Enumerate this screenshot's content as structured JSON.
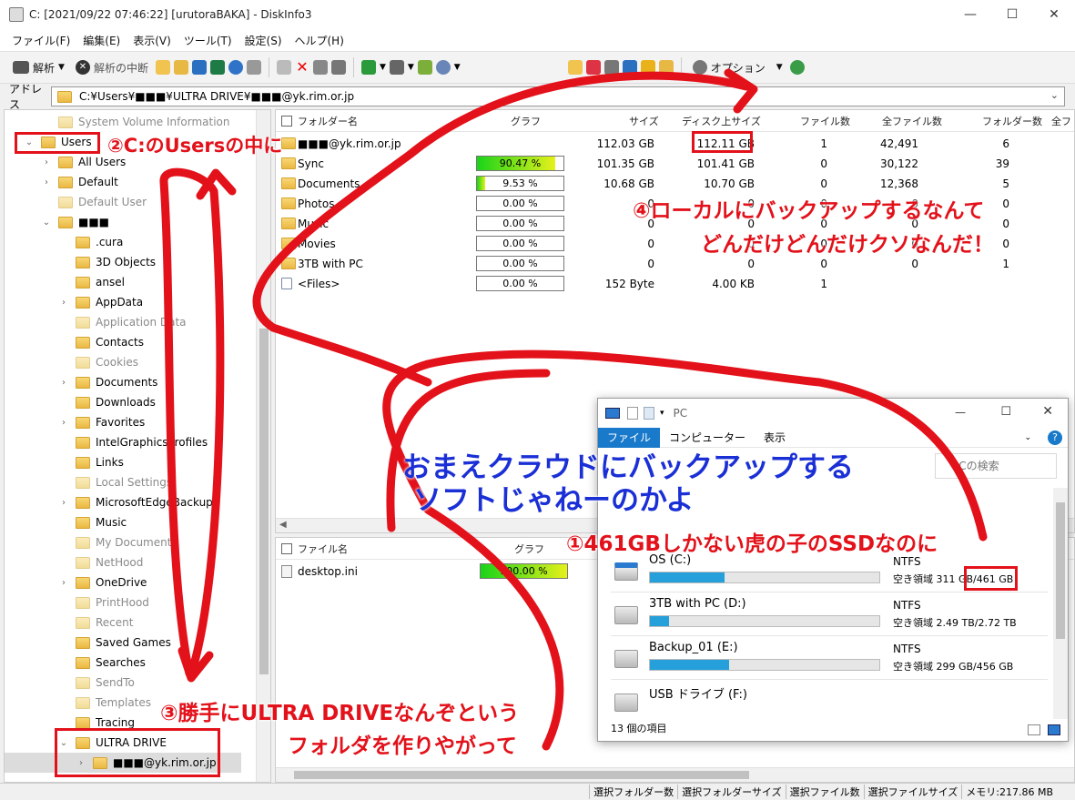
{
  "window": {
    "title": "C: [2021/09/22 07:46:22] [urutoraBAKA] - DiskInfo3",
    "minimize": "—",
    "maximize": "☐",
    "close": "✕"
  },
  "menu": [
    "ファイル(F)",
    "編集(E)",
    "表示(V)",
    "ツール(T)",
    "設定(S)",
    "ヘルプ(H)"
  ],
  "toolbar": {
    "analyze_label": "解析",
    "stop_label": "解析の中断",
    "options_label": "オプション"
  },
  "address": {
    "label": "アドレス",
    "path": "C:¥Users¥■■■¥ULTRA DRIVE¥■■■@yk.rim.or.jp"
  },
  "tree": [
    {
      "label": "System Volume Information",
      "indent": 1,
      "expander": "",
      "dim": true
    },
    {
      "label": "Users",
      "indent": 0,
      "expander": "⌄",
      "dim": false
    },
    {
      "label": "All Users",
      "indent": 1,
      "expander": "›",
      "dim": false
    },
    {
      "label": "Default",
      "indent": 1,
      "expander": "›",
      "dim": false
    },
    {
      "label": "Default User",
      "indent": 1,
      "expander": "",
      "dim": true
    },
    {
      "label": "■■■",
      "indent": 1,
      "expander": "⌄",
      "dim": false
    },
    {
      "label": ".cura",
      "indent": 2,
      "expander": "",
      "dim": false
    },
    {
      "label": "3D Objects",
      "indent": 2,
      "expander": "",
      "dim": false
    },
    {
      "label": "ansel",
      "indent": 2,
      "expander": "",
      "dim": false
    },
    {
      "label": "AppData",
      "indent": 2,
      "expander": "›",
      "dim": false
    },
    {
      "label": "Application Data",
      "indent": 2,
      "expander": "",
      "dim": true
    },
    {
      "label": "Contacts",
      "indent": 2,
      "expander": "",
      "dim": false
    },
    {
      "label": "Cookies",
      "indent": 2,
      "expander": "",
      "dim": true
    },
    {
      "label": "Documents",
      "indent": 2,
      "expander": "›",
      "dim": false
    },
    {
      "label": "Downloads",
      "indent": 2,
      "expander": "",
      "dim": false
    },
    {
      "label": "Favorites",
      "indent": 2,
      "expander": "›",
      "dim": false
    },
    {
      "label": "IntelGraphicsProfiles",
      "indent": 2,
      "expander": "",
      "dim": false
    },
    {
      "label": "Links",
      "indent": 2,
      "expander": "",
      "dim": false
    },
    {
      "label": "Local Settings",
      "indent": 2,
      "expander": "",
      "dim": true
    },
    {
      "label": "MicrosoftEdgeBackups",
      "indent": 2,
      "expander": "›",
      "dim": false
    },
    {
      "label": "Music",
      "indent": 2,
      "expander": "",
      "dim": false
    },
    {
      "label": "My Documents",
      "indent": 2,
      "expander": "",
      "dim": true
    },
    {
      "label": "NetHood",
      "indent": 2,
      "expander": "",
      "dim": true
    },
    {
      "label": "OneDrive",
      "indent": 2,
      "expander": "›",
      "dim": false
    },
    {
      "label": "PrintHood",
      "indent": 2,
      "expander": "",
      "dim": true
    },
    {
      "label": "Recent",
      "indent": 2,
      "expander": "",
      "dim": true
    },
    {
      "label": "Saved Games",
      "indent": 2,
      "expander": "",
      "dim": false
    },
    {
      "label": "Searches",
      "indent": 2,
      "expander": "",
      "dim": false
    },
    {
      "label": "SendTo",
      "indent": 2,
      "expander": "",
      "dim": true
    },
    {
      "label": "Templates",
      "indent": 2,
      "expander": "",
      "dim": true
    },
    {
      "label": "Tracing",
      "indent": 2,
      "expander": "",
      "dim": false
    },
    {
      "label": "ULTRA DRIVE",
      "indent": 2,
      "expander": "⌄",
      "dim": false
    },
    {
      "label": "■■■@yk.rim.or.jp",
      "indent": 3,
      "expander": "›",
      "dim": false
    }
  ],
  "folder_table": {
    "columns": [
      "フォルダー名",
      "グラフ",
      "サイズ",
      "ディスク上サイズ",
      "ファイル数",
      "全ファイル数",
      "フォルダー数",
      "全フ"
    ],
    "rows": [
      {
        "name": "■■■@yk.rim.or.jp",
        "bar": null,
        "bar_label": "",
        "size": "112.03 GB",
        "disk": "112.11 GB",
        "files": "1",
        "allfiles": "42,491",
        "folders": "6"
      },
      {
        "name": "Sync",
        "bar": 90.47,
        "bar_label": "90.47 %",
        "size": "101.35 GB",
        "disk": "101.41 GB",
        "files": "0",
        "allfiles": "30,122",
        "folders": "39"
      },
      {
        "name": "Documents",
        "bar": 9.53,
        "bar_label": "9.53 %",
        "size": "10.68 GB",
        "disk": "10.70 GB",
        "files": "0",
        "allfiles": "12,368",
        "folders": "5"
      },
      {
        "name": "Photos",
        "bar": 0,
        "bar_label": "0.00 %",
        "size": "0",
        "disk": "0",
        "files": "0",
        "allfiles": "0",
        "folders": "0"
      },
      {
        "name": "Music",
        "bar": 0,
        "bar_label": "0.00 %",
        "size": "0",
        "disk": "0",
        "files": "0",
        "allfiles": "0",
        "folders": "0"
      },
      {
        "name": "Movies",
        "bar": 0,
        "bar_label": "0.00 %",
        "size": "0",
        "disk": "0",
        "files": "0",
        "allfiles": "0",
        "folders": "0"
      },
      {
        "name": "3TB with PC",
        "bar": 0,
        "bar_label": "0.00 %",
        "size": "0",
        "disk": "0",
        "files": "0",
        "allfiles": "0",
        "folders": "1"
      },
      {
        "name": "<Files>",
        "bar": 0,
        "bar_label": "0.00 %",
        "size": "152 Byte",
        "disk": "4.00 KB",
        "files": "1",
        "allfiles": "",
        "folders": ""
      }
    ]
  },
  "file_table": {
    "columns": [
      "ファイル名",
      "グラフ"
    ],
    "rows": [
      {
        "name": "desktop.ini",
        "bar": 100,
        "bar_label": "100.00 %"
      }
    ]
  },
  "status": [
    "選択フォルダー数",
    "選択フォルダーサイズ",
    "選択ファイル数",
    "選択ファイルサイズ",
    "メモリ:217.86 MB"
  ],
  "pc_window": {
    "title": "PC",
    "ribbon": [
      "ファイル",
      "コンピューター",
      "表示"
    ],
    "search_placeholder": "PCの検索",
    "help": "?",
    "drives": [
      {
        "name": "OS (C:)",
        "fs": "NTFS",
        "free": "空き領域 311 GB/461 GB",
        "used": 32.5
      },
      {
        "name": "3TB with PC (D:)",
        "fs": "NTFS",
        "free": "空き領域 2.49 TB/2.72 TB",
        "used": 8.5
      },
      {
        "name": "Backup_01 (E:)",
        "fs": "NTFS",
        "free": "空き領域 299 GB/456 GB",
        "used": 34.4
      },
      {
        "name": "USB ドライブ (F:)",
        "fs": "",
        "free": "",
        "used": null
      }
    ],
    "item_count": "13 個の項目"
  },
  "annotations": {
    "a1": "①461GBしかない虎の子のSSDなのに",
    "a2": "②C:のUsersの中に",
    "a3_line1": "③勝手にULTRA DRIVEなんぞという",
    "a3_line2": "フォルダを作りやがって",
    "a4_line1": "④ローカルにバックアップするなんて",
    "a4_line2": "どんだけどんだけクソなんだ！",
    "blue_line1": "おまえクラウドにバックアップする",
    "blue_line2": "ソフトじゃねーのかよ"
  },
  "colors": {
    "annotation_red": "#e3111a",
    "annotation_blue": "#1a2fd6",
    "drive_bar": "#26a0da",
    "ribbon_active": "#1979ca"
  }
}
